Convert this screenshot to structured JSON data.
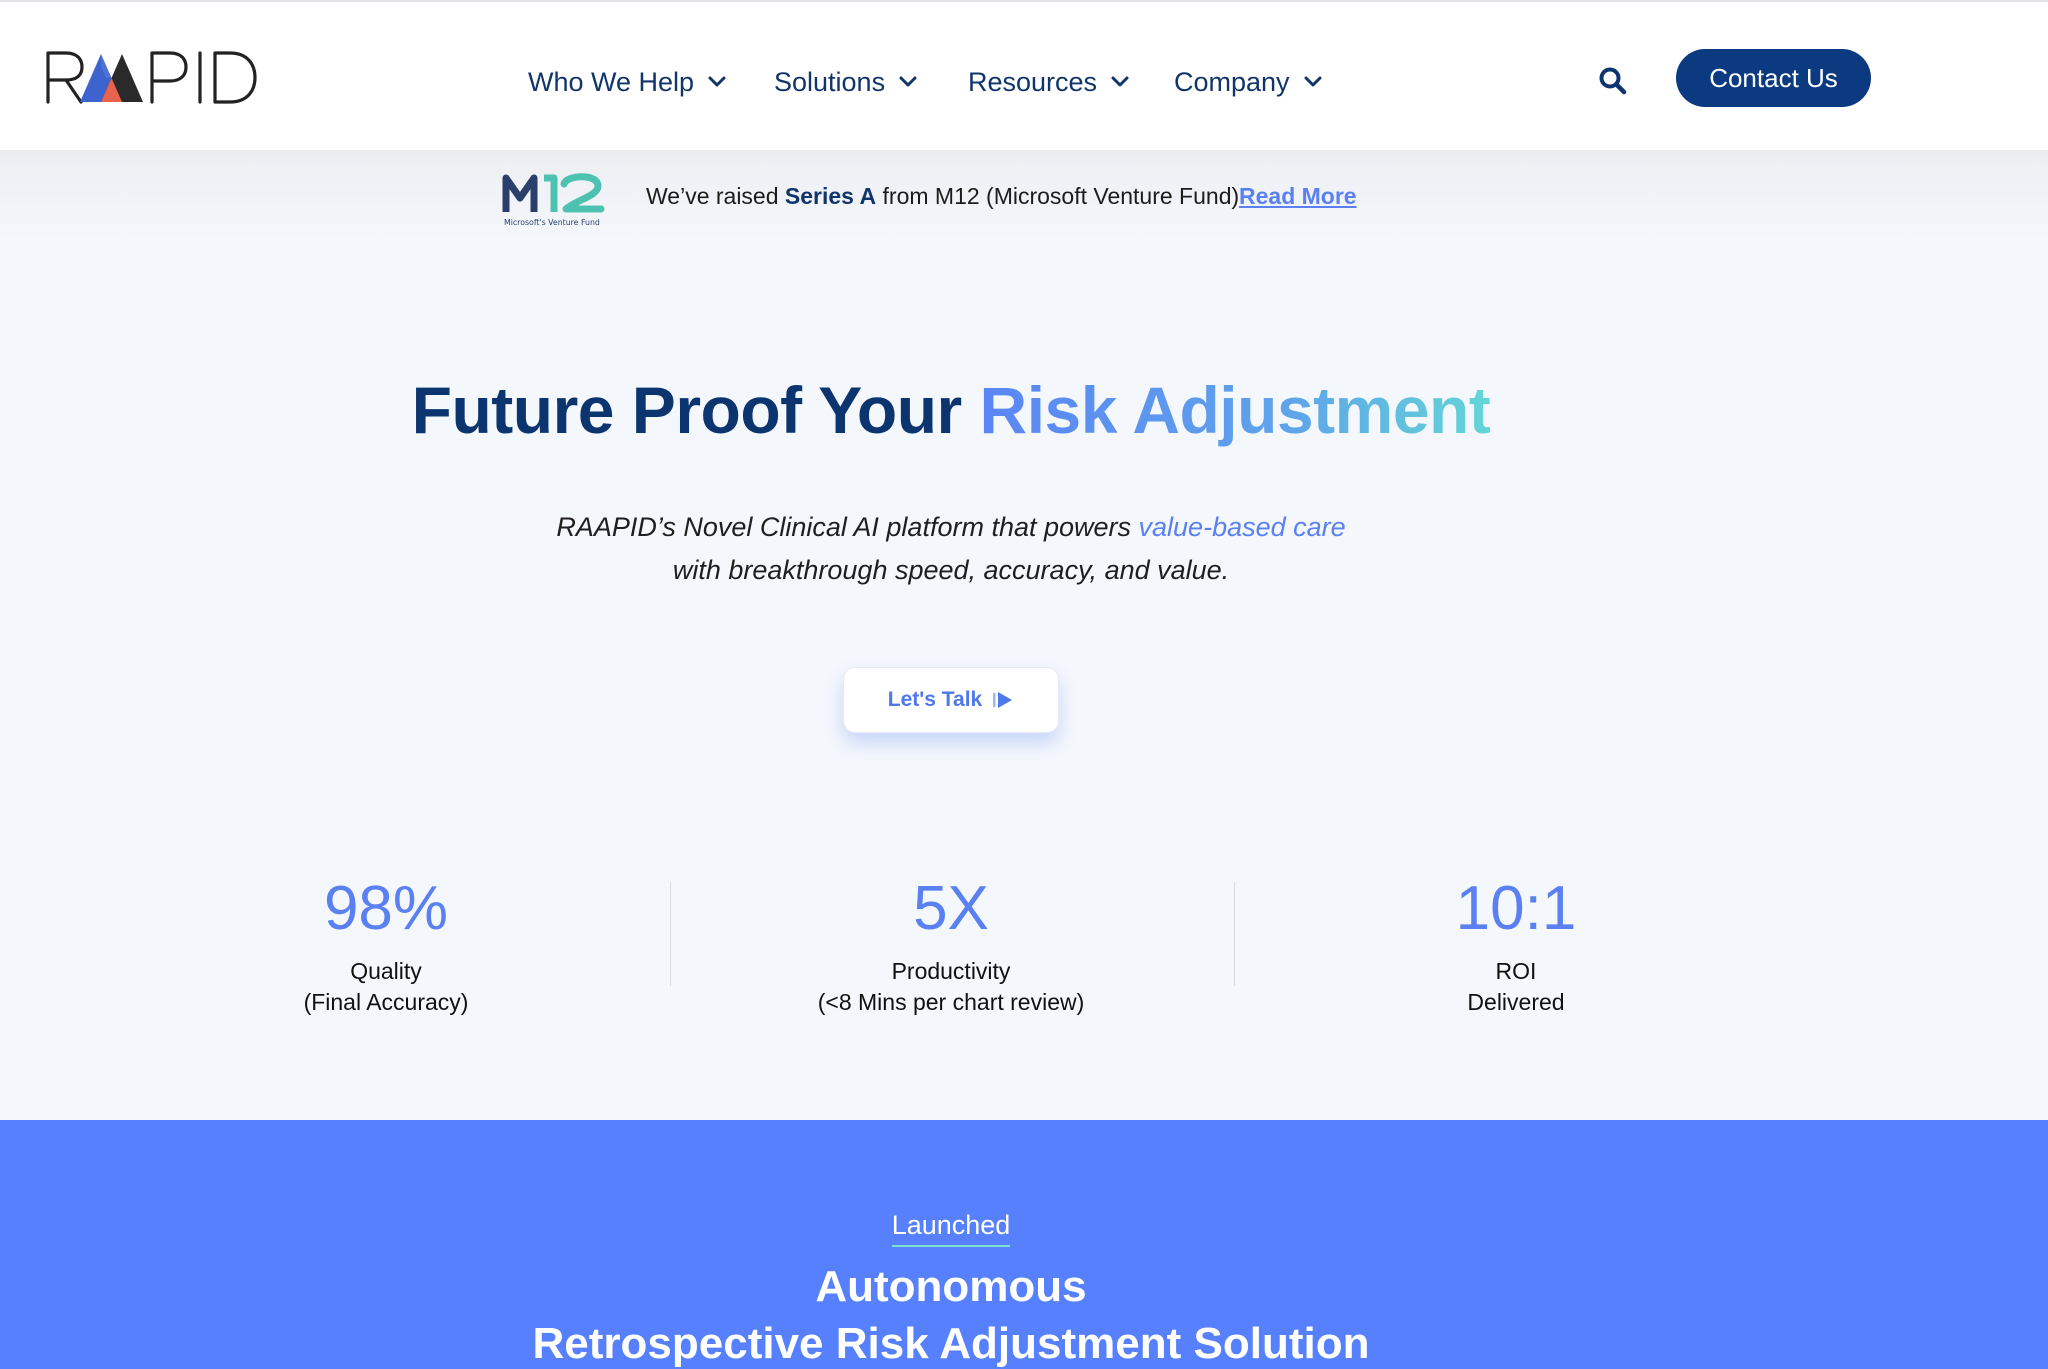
{
  "header": {
    "logo_text": "RAAPID",
    "nav": [
      {
        "label": "Who We Help",
        "icon": "chevron-down-icon"
      },
      {
        "label": "Solutions",
        "icon": "chevron-down-icon"
      },
      {
        "label": "Resources",
        "icon": "chevron-down-icon"
      },
      {
        "label": "Company",
        "icon": "chevron-down-icon"
      }
    ],
    "search_icon": "search-icon",
    "contact_label": "Contact Us"
  },
  "announcement": {
    "partner_logo_text": "M12",
    "partner_logo_caption": "Microsoft's Venture Fund",
    "text_before": "We’ve raised ",
    "text_strong": "Series A",
    "text_after": " from M12 (Microsoft Venture Fund).",
    "link_label": "Read More"
  },
  "hero": {
    "title_main": "Future Proof Your ",
    "title_accent": "Risk Adjustment",
    "subtitle_line1": "RAAPID’s Novel Clinical AI platform that powers ",
    "subtitle_accent": "value-based care",
    "subtitle_line2": "with breakthrough speed, accuracy, and value.",
    "cta_label": "Let's Talk",
    "cta_icon": "play-arrow-icon"
  },
  "stats": [
    {
      "value": "98%",
      "label_line1": "Quality",
      "label_line2": "(Final Accuracy)"
    },
    {
      "value": "5X",
      "label_line1": "Productivity",
      "label_line2": "(<8 Mins per chart review)"
    },
    {
      "value": "10:1",
      "label_line1": "ROI",
      "label_line2": "Delivered"
    }
  ],
  "band": {
    "eyebrow": "Launched",
    "title_line1": "Autonomous",
    "title_line2": "Retrospective Risk Adjustment Solution"
  },
  "colors": {
    "navy": "#10356b",
    "button_navy": "#0c3a80",
    "accent_blue": "#5a80f2",
    "band_blue": "#5680fd",
    "teal": "#63d6d6",
    "page_bg": "#f4f7fc"
  }
}
